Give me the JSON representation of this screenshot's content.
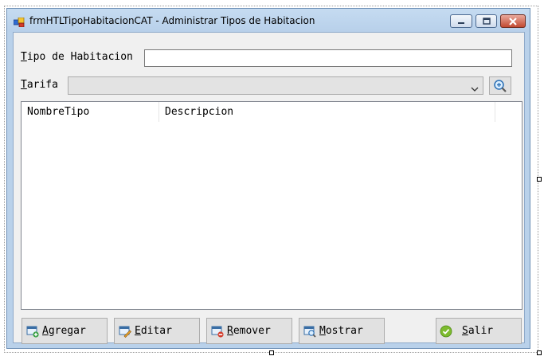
{
  "window": {
    "title": "frmHTLTipoHabitacionCAT - Administrar Tipos de Habitacion"
  },
  "form": {
    "tipo_label_first": "T",
    "tipo_label_rest": "ipo de Habitacion",
    "tipo_value": "",
    "tarifa_label_first": "T",
    "tarifa_label_rest": "arifa",
    "tarifa_selected": ""
  },
  "list": {
    "columns": [
      "NombreTipo",
      "Descripcion"
    ],
    "rows": []
  },
  "buttons": {
    "agregar": {
      "first": "A",
      "rest": "gregar"
    },
    "editar": {
      "first": "E",
      "rest": "ditar"
    },
    "remover": {
      "first": "R",
      "rest": "emover"
    },
    "mostrar": {
      "first": "M",
      "rest": "ostrar"
    },
    "salir": {
      "first": "S",
      "rest": "alir"
    }
  },
  "icons": {
    "app": "form-icon",
    "search": "magnifier-plus-icon",
    "agregar": "add-icon",
    "editar": "edit-icon",
    "remover": "remove-icon",
    "mostrar": "view-icon",
    "salir": "check-icon"
  }
}
